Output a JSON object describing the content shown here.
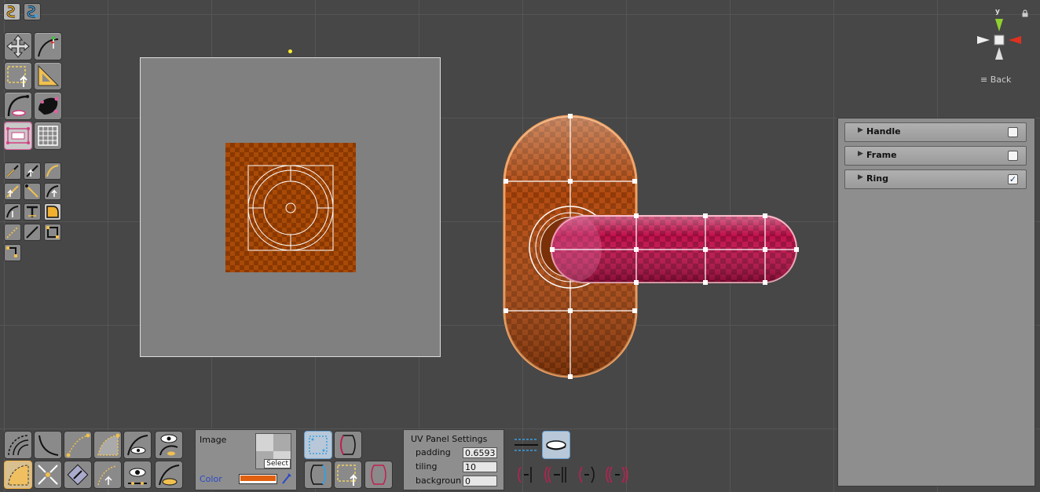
{
  "top_tools": [
    {
      "name": "spline-tool-icon"
    },
    {
      "name": "spline-alt-tool-icon"
    }
  ],
  "view_gizmo": {
    "axis_label": "y",
    "back_label": "Back"
  },
  "layers_panel": {
    "items": [
      {
        "label": "Handle",
        "checked": false
      },
      {
        "label": "Frame",
        "checked": false
      },
      {
        "label": "Ring",
        "checked": true
      }
    ]
  },
  "image_panel": {
    "image_label": "Image",
    "select_label": "Select",
    "color_label": "Color",
    "color_value": "#e06010"
  },
  "uv_panel": {
    "title": "UV Panel Settings",
    "padding_label": "padding",
    "padding_value": "0.6593",
    "tiling_label": "tiling",
    "tiling_value": "10",
    "background_label": "backgroun",
    "background_value": "0"
  },
  "colors": {
    "accent_orange": "#e06010",
    "selection_pink": "#c0104a",
    "viewport_bg": "#474747"
  }
}
